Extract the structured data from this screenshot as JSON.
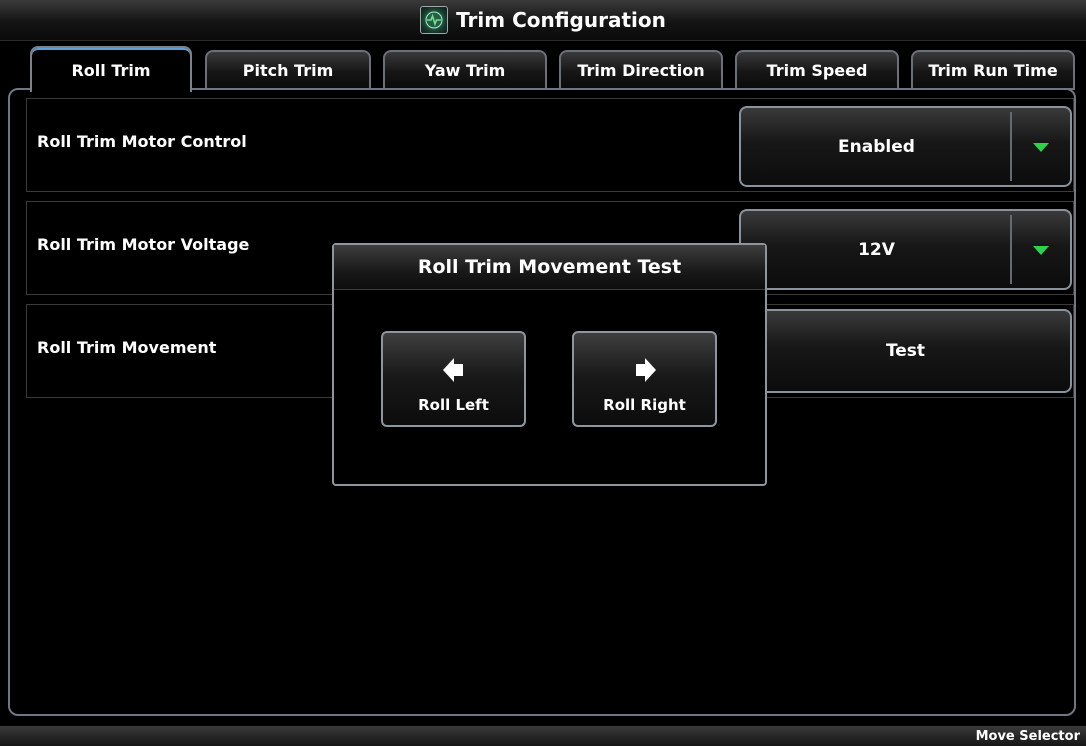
{
  "title": "Trim Configuration",
  "icons": {
    "app": "pilot-display-icon"
  },
  "tabs": [
    {
      "label": "Roll Trim",
      "active": true
    },
    {
      "label": "Pitch Trim",
      "active": false
    },
    {
      "label": "Yaw Trim",
      "active": false
    },
    {
      "label": "Trim Direction",
      "active": false
    },
    {
      "label": "Trim Speed",
      "active": false
    },
    {
      "label": "Trim Run Time",
      "active": false
    }
  ],
  "settings": {
    "motor_control": {
      "label": "Roll Trim Motor Control",
      "value": "Enabled"
    },
    "motor_voltage": {
      "label": "Roll Trim Motor Voltage",
      "value": "12V"
    },
    "movement": {
      "label": "Roll Trim Movement",
      "button": "Test"
    }
  },
  "popup": {
    "title": "Roll Trim Movement Test",
    "left_button": "Roll Left",
    "right_button": "Roll Right"
  },
  "softkeys": {
    "move_selector": "Move Selector"
  },
  "colors": {
    "accent_arrow": "#2ed14a",
    "active_tab_highlight": "#5aa0d8",
    "border": "#8d959d"
  }
}
